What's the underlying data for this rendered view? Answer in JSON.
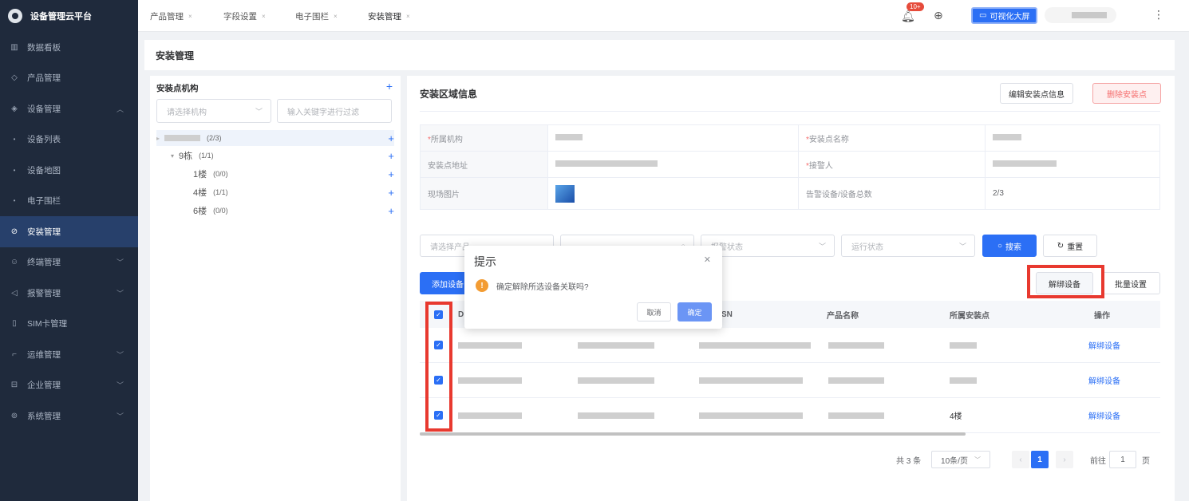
{
  "app": {
    "title": "设备管理云平台"
  },
  "sidebar": {
    "items": [
      {
        "label": "数据看板",
        "icon": "bar-chart-icon"
      },
      {
        "label": "产品管理",
        "icon": "cube-icon"
      },
      {
        "label": "设备管理",
        "icon": "layers-icon"
      },
      {
        "label": "设备列表",
        "icon": "dot-icon"
      },
      {
        "label": "设备地图",
        "icon": "dot-icon"
      },
      {
        "label": "电子围栏",
        "icon": "dot-icon"
      },
      {
        "label": "安装管理",
        "icon": "settings-icon"
      },
      {
        "label": "终端管理",
        "icon": "user-icon"
      },
      {
        "label": "报警管理",
        "icon": "alarm-icon"
      },
      {
        "label": "SIM卡管理",
        "icon": "sim-icon"
      },
      {
        "label": "运维管理",
        "icon": "tool-icon"
      },
      {
        "label": "企业管理",
        "icon": "building-icon"
      },
      {
        "label": "系统管理",
        "icon": "gear-icon"
      }
    ]
  },
  "tabs": [
    {
      "label": "产品管理"
    },
    {
      "label": "字段设置"
    },
    {
      "label": "电子围栏"
    },
    {
      "label": "安装管理"
    }
  ],
  "topbar": {
    "badge": "10+",
    "screen_button": "可视化大屏"
  },
  "page": {
    "title": "安装管理"
  },
  "tree": {
    "title": "安装点机构",
    "select_placeholder": "请选择机构",
    "search_placeholder": "输入关键字进行过滤",
    "nodes": [
      {
        "label": "",
        "count": "(2/3)"
      },
      {
        "label": "9栋",
        "count": "(1/1)"
      },
      {
        "label": "1楼",
        "count": "(0/0)"
      },
      {
        "label": "4楼",
        "count": "(1/1)"
      },
      {
        "label": "6楼",
        "count": "(0/0)"
      }
    ]
  },
  "area": {
    "title": "安装区域信息",
    "edit_button": "编辑安装点信息",
    "delete_button": "删除安装点",
    "labels": {
      "org": "所属机构",
      "site_name": "安装点名称",
      "address": "安装点地址",
      "contact": "接警人",
      "photo": "现场图片",
      "ratio": "告警设备/设备总数"
    },
    "ratio_value": "2/3"
  },
  "filters": {
    "product_placeholder": "请选择产品",
    "device_placeholder": "",
    "alarm_status": "报警状态",
    "run_status": "运行状态",
    "search_button": "搜索",
    "reset_button": "重置"
  },
  "actions": {
    "add_device": "添加设备",
    "unbind_device": "解绑设备",
    "batch_setting": "批量设置"
  },
  "table": {
    "headers": [
      "D",
      "SN",
      "产品名称",
      "所属安装点",
      "操作"
    ],
    "rows": [
      {
        "site": "",
        "action": "解绑设备"
      },
      {
        "site": "",
        "action": "解绑设备"
      },
      {
        "site": "4楼",
        "action": "解绑设备"
      }
    ]
  },
  "pagination": {
    "total": "共 3 条",
    "page_size": "10条/页",
    "current": "1",
    "goto_label": "前往",
    "goto_value": "1",
    "page_unit": "页"
  },
  "modal": {
    "title": "提示",
    "message": "确定解除所选设备关联吗?",
    "cancel": "取消",
    "confirm": "确定"
  }
}
